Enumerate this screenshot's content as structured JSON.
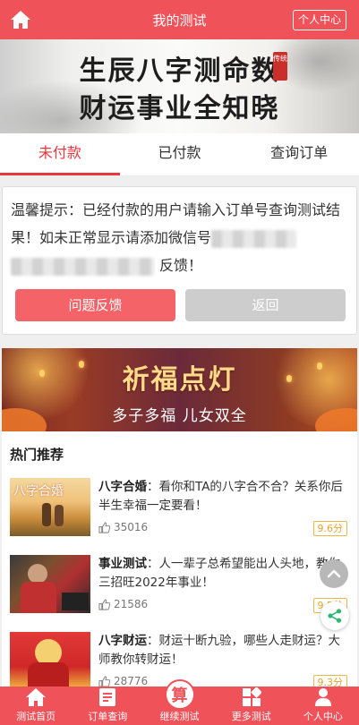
{
  "header": {
    "title": "我的测试",
    "right_button": "个人中心",
    "home_icon": "home-icon"
  },
  "banner": {
    "line1": "生辰八字测命数",
    "line2": "财运事业全知晓",
    "seal": "传统"
  },
  "tabs": [
    {
      "label": "未付款",
      "active": true
    },
    {
      "label": "已付款",
      "active": false
    },
    {
      "label": "查询订单",
      "active": false
    }
  ],
  "notice": {
    "text_part1": "温馨提示：已经付款的用户请输入订单号查询测试结果！如未正常显示请添加微信号",
    "text_part2": "反馈！",
    "feedback_button": "问题反馈",
    "back_button": "返回"
  },
  "promo": {
    "title": "祈福点灯",
    "subtitle": "多子多福  儿女双全"
  },
  "hot": {
    "title": "热门推荐",
    "items": [
      {
        "name": "八字合婚",
        "desc": "：看你和TA的八字合不合？关系你后半生幸福一定要看！",
        "likes": "35016",
        "score": "9.6分",
        "thumb_text": "八字合婚"
      },
      {
        "name": "事业测试",
        "desc": "：人一辈子总希望能出人头地，教你三招旺2022年事业！",
        "likes": "21586",
        "score": "9.5分",
        "thumb_text": ""
      },
      {
        "name": "八字财运",
        "desc": "：财运十断九验，哪些人走财运？大师教你转财运！",
        "likes": "28776",
        "score": "9.3分",
        "thumb_text": ""
      }
    ]
  },
  "floating": {
    "up_icon": "chevron-up-icon",
    "share_icon": "share-icon"
  },
  "bottom_nav": [
    {
      "label": "测试首页",
      "icon": "home-icon"
    },
    {
      "label": "订单查询",
      "icon": "order-icon"
    },
    {
      "label": "继续测试",
      "icon": "calc-icon",
      "glyph": "算"
    },
    {
      "label": "更多测试",
      "icon": "grid-icon"
    },
    {
      "label": "个人中心",
      "icon": "user-icon"
    }
  ],
  "colors": {
    "brand": "#f0525a",
    "active_tab": "#e8383f",
    "score_border": "#e6b94a"
  }
}
